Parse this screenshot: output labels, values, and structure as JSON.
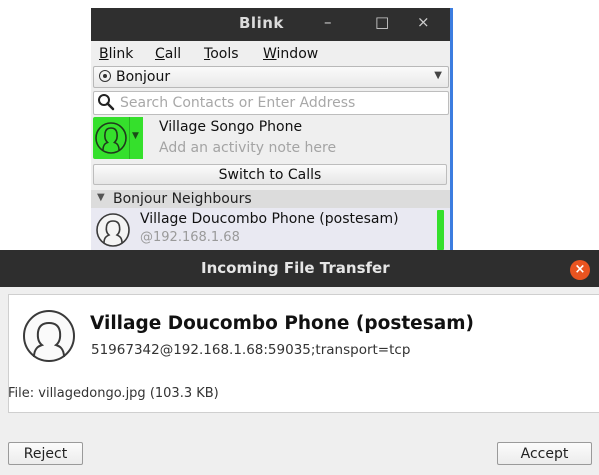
{
  "blink_window": {
    "title": "Blink",
    "controls": {
      "minimize": "–",
      "maximize": "□",
      "close": "×"
    },
    "menu": [
      "Blink",
      "Call",
      "Tools",
      "Window"
    ],
    "account": {
      "selected": "Bonjour"
    },
    "search": {
      "placeholder": "Search Contacts or Enter Address",
      "value": ""
    },
    "me": {
      "name": "Village Songo Phone",
      "note_placeholder": "Add an activity note here"
    },
    "switch_label": "Switch to Calls",
    "group": {
      "name": "Bonjour Neighbours"
    },
    "contacts": [
      {
        "name": "Village Doucombo Phone (postesam)",
        "address": "@192.168.1.68",
        "presence": "available"
      }
    ],
    "colors": {
      "presence_green": "#35e02c",
      "accent": "#3c7de0"
    }
  },
  "dialog": {
    "title": "Incoming File Transfer",
    "peer_name": "Village Doucombo Phone (postesam)",
    "peer_uri": "51967342@192.168.1.68:59035;transport=tcp",
    "file_info": "File: villagedongo.jpg (103.3 KB)",
    "reject_label": "Reject",
    "accept_label": "Accept",
    "close_color": "#e95420"
  }
}
